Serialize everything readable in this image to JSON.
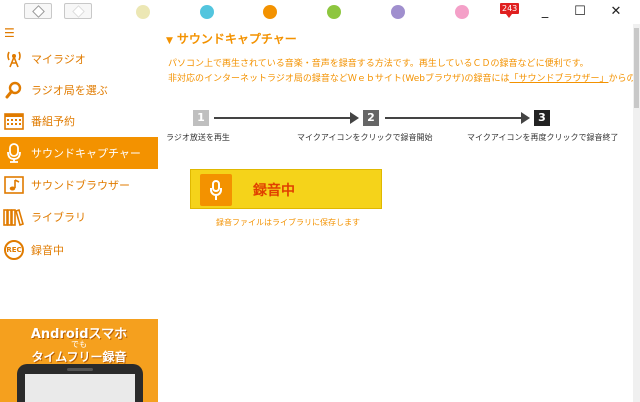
{
  "titlebar": {
    "notification_count": "243",
    "dot_colors": [
      "#ece7b4",
      "#53c5de",
      "#f39200",
      "#8dc63f",
      "#a08fce",
      "#f4a0c8"
    ],
    "minimize": "_",
    "maximize": "☐",
    "close": "✕"
  },
  "sidebar": {
    "items": [
      {
        "label": "マイラジオ",
        "icon": "antenna-icon"
      },
      {
        "label": "ラジオ局を選ぶ",
        "icon": "magnifier-icon"
      },
      {
        "label": "番組予約",
        "icon": "calendar-icon"
      },
      {
        "label": "サウンドキャプチャー",
        "icon": "microphone-icon"
      },
      {
        "label": "サウンドブラウザー",
        "icon": "music-note-icon"
      },
      {
        "label": "ライブラリ",
        "icon": "books-icon"
      },
      {
        "label": "録音中",
        "icon": "rec-icon",
        "icon_text": "REC"
      }
    ],
    "active_index": 3,
    "promo": {
      "line1": "Androidスマホ",
      "line2": "でも",
      "line3": "タイムフリー録音"
    }
  },
  "main": {
    "title": "サウンドキャプチャー",
    "desc1": "パソコン上で再生されている音楽・音声を録音する方法です。再生しているＣＤの録音などに便利です。",
    "desc2_pre": "非対応のインターネットラジオ局の録音などＷｅｂサイト(Webブラウザ)の録音には",
    "desc2_link": "「サウンドブラウザー」",
    "desc2_post": "からの録音が",
    "steps": [
      {
        "num": "1",
        "label": "ラジオ放送を再生"
      },
      {
        "num": "2",
        "label": "マイクアイコンをクリックで録音開始"
      },
      {
        "num": "3",
        "label": "マイクアイコンを再度クリックで録音終了"
      }
    ],
    "record_status": "録音中",
    "saved_note": "録音ファイルはライブラリに保存します"
  },
  "colors": {
    "accent": "#f39200",
    "record_bar": "#f5d31a",
    "record_text": "#e04000"
  }
}
